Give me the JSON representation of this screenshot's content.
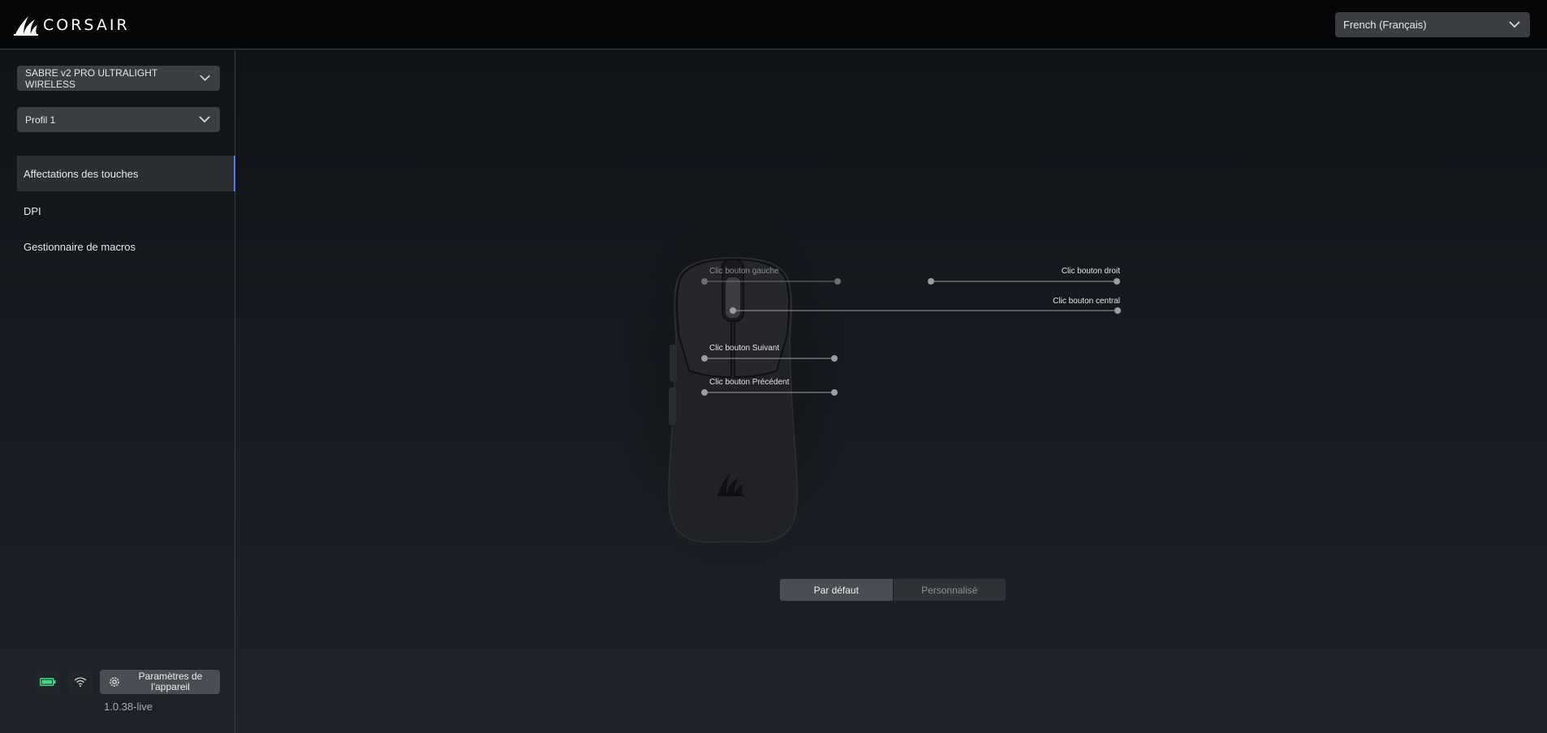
{
  "header": {
    "brand": "CORSAIR",
    "language": "French (Français)"
  },
  "sidebar": {
    "device": "SABRE v2 PRO ULTRALIGHT WIRELESS",
    "profile": "Profil 1",
    "nav": [
      {
        "label": "Affectations des touches",
        "active": true
      },
      {
        "label": "DPI",
        "active": false
      },
      {
        "label": "Gestionnaire de macros",
        "active": false
      }
    ],
    "settings_label": "Paramètres de l'appareil",
    "version": "1.0.38-live"
  },
  "mouse": {
    "callouts": {
      "left": "Clic bouton gauche",
      "right": "Clic bouton droit",
      "middle": "Clic bouton central",
      "forward": "Clic bouton Suivant",
      "back": "Clic bouton Précédent"
    }
  },
  "mode_toggle": {
    "default_label": "Par défaut",
    "custom_label": "Personnalisé",
    "selected": "Par défaut"
  },
  "colors": {
    "accent": "#5b7be8",
    "battery": "#3ddc84"
  },
  "icons": [
    "corsair-logo-icon",
    "chevron-down-icon",
    "battery-icon",
    "wifi-icon",
    "gear-icon"
  ]
}
